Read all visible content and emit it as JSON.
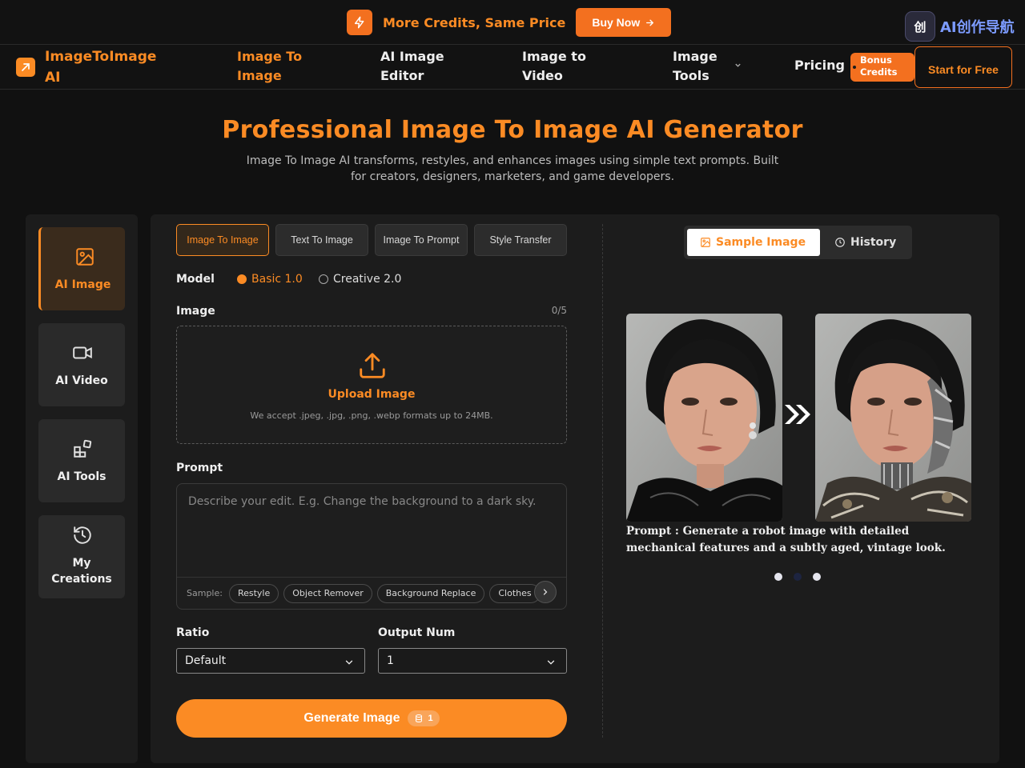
{
  "promo": {
    "text": "More Credits, Same Price",
    "buy_label": "Buy Now",
    "partner_badge": "创",
    "partner_name": "AI创作导航"
  },
  "nav": {
    "brand": "ImageToImage AI",
    "items": [
      "Image To Image",
      "AI Image Editor",
      "Image to Video",
      "Image Tools"
    ],
    "pricing": "Pricing",
    "bonus": "Bonus Credits",
    "start": "Start for Free"
  },
  "hero": {
    "title": "Professional Image To Image AI Generator",
    "subtitle": "Image To Image AI transforms, restyles, and enhances images using simple text prompts. Built for creators, designers, marketers, and game developers."
  },
  "rail": [
    "AI Image",
    "AI Video",
    "AI Tools",
    "My Creations"
  ],
  "tabs": [
    "Image To Image",
    "Text To Image",
    "Image To Prompt",
    "Style Transfer"
  ],
  "form": {
    "model_label": "Model",
    "model_options": [
      "Basic 1.0",
      "Creative 2.0"
    ],
    "image_label": "Image",
    "image_count": "0/5",
    "upload_title": "Upload Image",
    "upload_sub": "We accept .jpeg, .jpg, .png, .webp formats up to 24MB.",
    "prompt_label": "Prompt",
    "prompt_placeholder": "Describe your edit. E.g. Change the background to a dark sky.",
    "sample_label": "Sample:",
    "samples": [
      "Restyle",
      "Object Remover",
      "Background Replace",
      "Clothes"
    ],
    "ratio_label": "Ratio",
    "ratio_value": "Default",
    "output_label": "Output Num",
    "output_value": "1",
    "generate_label": "Generate Image",
    "generate_cost": "1"
  },
  "preview": {
    "sample_tab": "Sample Image",
    "history_tab": "History",
    "caption": "Prompt : Generate a robot image with detailed mechanical features and a subtly aged, vintage look."
  },
  "colors": {
    "accent": "#fb8b24",
    "banner_accent": "#f3701f",
    "background": "#111111",
    "panel": "#1c1c1c"
  }
}
